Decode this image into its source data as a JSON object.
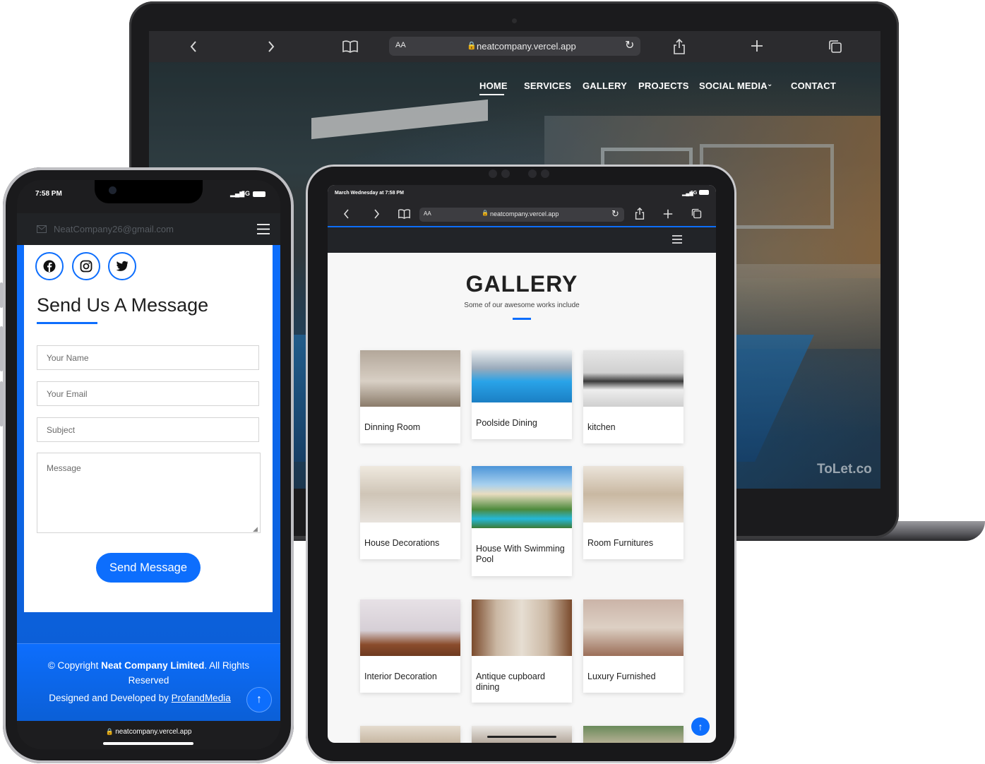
{
  "laptop": {
    "safari": {
      "text_size": "AA",
      "url": "neatcompany.vercel.app",
      "icons": [
        "chevron-left-icon",
        "chevron-right-icon",
        "book-icon",
        "lock-icon",
        "reload-icon",
        "share-icon",
        "plus-icon",
        "tabs-icon"
      ]
    },
    "nav": {
      "items": [
        "HOME",
        "SERVICES",
        "GALLERY",
        "PROJECTS",
        "SOCIAL MEDIA",
        "CONTACT"
      ],
      "active": "HOME"
    },
    "watermark": "ToLet.co"
  },
  "tablet": {
    "status": {
      "time": "March Wednesday at 7:58 PM",
      "signal": "5G"
    },
    "safari": {
      "text_size": "AA",
      "url": "neatcompany.vercel.app"
    },
    "gallery": {
      "title": "GALLERY",
      "subtitle": "Some of our awesome works include",
      "items": [
        {
          "title": "Dinning Room"
        },
        {
          "title": "Poolside Dining"
        },
        {
          "title": "kitchen"
        },
        {
          "title": "House Decorations"
        },
        {
          "title": "House With Swimming Pool"
        },
        {
          "title": "Room Furnitures"
        },
        {
          "title": "Interior Decoration"
        },
        {
          "title": "Antique cupboard dining"
        },
        {
          "title": "Luxury Furnished"
        }
      ]
    }
  },
  "phone": {
    "status": {
      "time": "7:58 PM",
      "signal": "5G"
    },
    "header": {
      "email": "NeatCompany26@gmail.com"
    },
    "social_icons": [
      "facebook-icon",
      "instagram-icon",
      "twitter-icon"
    ],
    "form": {
      "title": "Send Us A Message",
      "name_placeholder": "Your Name",
      "email_placeholder": "Your Email",
      "subject_placeholder": "Subject",
      "message_placeholder": "Message",
      "submit_label": "Send Message"
    },
    "footer": {
      "copyright_prefix": "© Copyright ",
      "company": "Neat Company Limited",
      "copyright_suffix": ". All Rights Reserved",
      "designed_prefix": "Designed and Developed by ",
      "designer": "ProfandMedia"
    },
    "bottom_url": "neatcompany.vercel.app"
  }
}
